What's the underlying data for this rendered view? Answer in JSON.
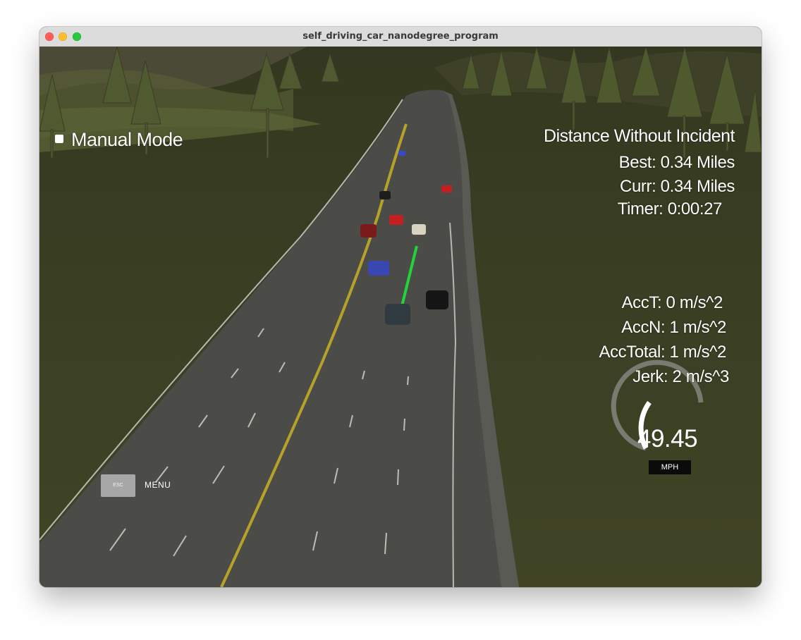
{
  "window": {
    "title": "self_driving_car_nanodegree_program"
  },
  "hud": {
    "mode_label": "Manual Mode",
    "distance_title": "Distance Without Incident",
    "best": "Best: 0.34 Miles",
    "curr": "Curr: 0.34 Miles",
    "timer": "Timer: 0:00:27",
    "acc_t": "AccT: 0 m/s^2",
    "acc_n": "AccN: 1 m/s^2",
    "acc_total": "AccTotal: 1 m/s^2",
    "jerk": "Jerk: 2 m/s^3"
  },
  "speedometer": {
    "value": "49.45",
    "unit": "MPH"
  },
  "menu": {
    "esc_label": "ESC",
    "menu_label": "MENU"
  },
  "colors": {
    "grass": "#3a3f22",
    "road": "#4a4a47",
    "lane_yellow": "#c9b22e",
    "path_green": "#22d43a"
  }
}
